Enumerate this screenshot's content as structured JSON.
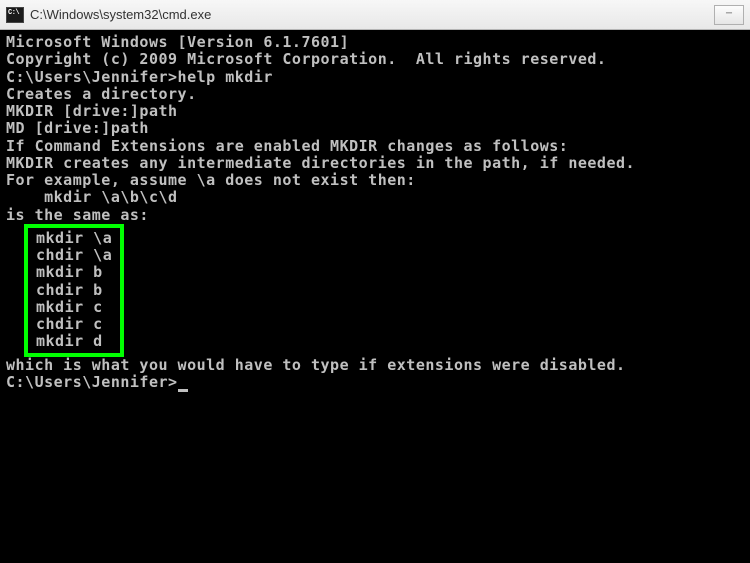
{
  "window": {
    "title": "C:\\Windows\\system32\\cmd.exe"
  },
  "terminal": {
    "header1": "Microsoft Windows [Version 6.1.7601]",
    "header2": "Copyright (c) 2009 Microsoft Corporation.  All rights reserved.",
    "blank": "",
    "prompt1": "C:\\Users\\Jennifer>help mkdir",
    "help1": "Creates a directory.",
    "syntax1": "MKDIR [drive:]path",
    "syntax2": "MD [drive:]path",
    "ext1": "If Command Extensions are enabled MKDIR changes as follows:",
    "ext2": "MKDIR creates any intermediate directories in the path, if needed.",
    "ext3": "For example, assume \\a does not exist then:",
    "example1": "    mkdir \\a\\b\\c\\d",
    "same": "is the same as:",
    "hl1": "mkdir \\a",
    "hl2": "chdir \\a",
    "hl3": "mkdir b",
    "hl4": "chdir b",
    "hl5": "mkdir c",
    "hl6": "chdir c",
    "hl7": "mkdir d",
    "footer": "which is what you would have to type if extensions were disabled.",
    "prompt2": "C:\\Users\\Jennifer>"
  }
}
